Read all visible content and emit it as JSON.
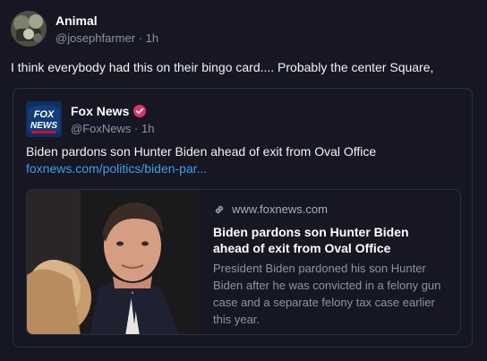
{
  "post": {
    "author": {
      "display_name": "Animal",
      "handle": "@josephfarmer",
      "separator": "·",
      "age": "1h"
    },
    "text": "I think everybody had this on their bingo card.... Probably the center Square,"
  },
  "quote": {
    "author": {
      "display_name": "Fox News",
      "handle": "@FoxNews",
      "separator": "·",
      "age": "1h",
      "logo_text_top": "FOX",
      "logo_text_bottom": "NEWS",
      "badge_color": "#e6306b"
    },
    "text": "Biden pardons son Hunter Biden ahead of exit from Oval Office",
    "link_text": "foxnews.com/politics/biden-par..."
  },
  "link_card": {
    "domain": "www.foxnews.com",
    "title": "Biden pardons son Hunter Biden ahead of exit from Oval Office",
    "description": "President Biden pardoned his son Hunter Biden after he was convicted in a felony gun case and a separate felony tax case earlier this year."
  },
  "colors": {
    "background": "#161723",
    "link": "#3d9fe8",
    "muted": "#8b93a7",
    "border": "#2c2f3f"
  }
}
